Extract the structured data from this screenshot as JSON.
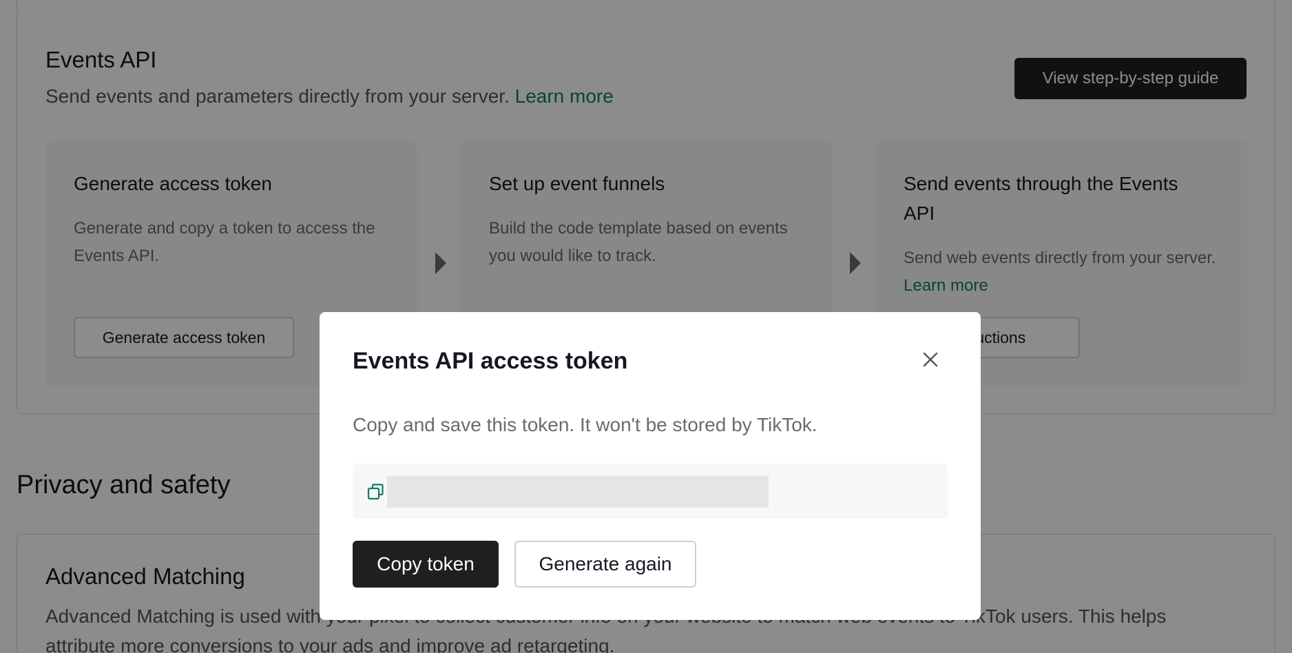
{
  "events_api": {
    "title": "Events API",
    "subtitle": "Send events and parameters directly from your server.",
    "learn_more": "Learn more",
    "guide_button": "View step-by-step guide",
    "steps": [
      {
        "title": "Generate access token",
        "description": "Generate and copy a token to access the Events API.",
        "button": "Generate access token"
      },
      {
        "title": "Set up event funnels",
        "description": "Build the code template based on events you would like to track."
      },
      {
        "title": "Send events through the Events API",
        "description": "Send web events directly from your server.",
        "learn_more": "Learn more",
        "button": "structions"
      }
    ]
  },
  "privacy": {
    "title": "Privacy and safety",
    "advanced_matching": {
      "title": "Advanced Matching",
      "description": "Advanced Matching is used with your pixel to collect customer info on your website to match web events to TikTok users. This helps attribute more conversions to your ads and improve ad retargeting."
    }
  },
  "modal": {
    "title": "Events API access token",
    "message": "Copy and save this token. It won't be stored by TikTok.",
    "copy_button": "Copy token",
    "generate_again_button": "Generate again",
    "icons": {
      "close": "close-icon",
      "copy": "copy-icon"
    }
  },
  "colors": {
    "accent_link": "#0f7a6a",
    "primary_button": "#1f1f1f",
    "overlay": "rgba(0,0,0,0.45)"
  }
}
